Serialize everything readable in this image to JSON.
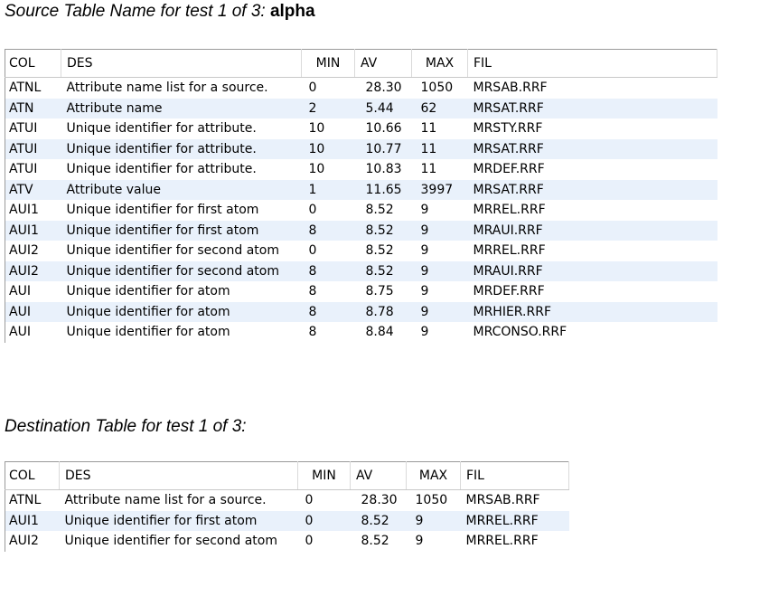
{
  "source": {
    "caption_italic": "Source Table Name for test 1 of 3: ",
    "caption_bold": "alpha",
    "headers": [
      "COL",
      "DES",
      "MIN",
      "AV",
      "MAX",
      "FIL"
    ],
    "rows": [
      [
        "ATNL",
        "Attribute name list for a source.",
        "0",
        "28.30",
        "1050",
        "MRSAB.RRF"
      ],
      [
        "ATN",
        "Attribute name",
        "2",
        "5.44",
        "62",
        "MRSAT.RRF"
      ],
      [
        "ATUI",
        "Unique identifier for attribute.",
        "10",
        "10.66",
        "11",
        "MRSTY.RRF"
      ],
      [
        "ATUI",
        "Unique identifier for attribute.",
        "10",
        "10.77",
        "11",
        "MRSAT.RRF"
      ],
      [
        "ATUI",
        "Unique identifier for attribute.",
        "10",
        "10.83",
        "11",
        "MRDEF.RRF"
      ],
      [
        "ATV",
        "Attribute value",
        "1",
        "11.65",
        "3997",
        "MRSAT.RRF"
      ],
      [
        "AUI1",
        "Unique identifier for first atom",
        "0",
        "8.52",
        "9",
        "MRREL.RRF"
      ],
      [
        "AUI1",
        "Unique identifier for first atom",
        "8",
        "8.52",
        "9",
        "MRAUI.RRF"
      ],
      [
        "AUI2",
        "Unique identifier for second atom",
        "0",
        "8.52",
        "9",
        "MRREL.RRF"
      ],
      [
        "AUI2",
        "Unique identifier for second atom",
        "8",
        "8.52",
        "9",
        "MRAUI.RRF"
      ],
      [
        "AUI",
        "Unique identifier for atom",
        "8",
        "8.75",
        "9",
        "MRDEF.RRF"
      ],
      [
        "AUI",
        "Unique identifier for atom",
        "8",
        "8.78",
        "9",
        "MRHIER.RRF"
      ],
      [
        "AUI",
        "Unique identifier for atom",
        "8",
        "8.84",
        "9",
        "MRCONSO.RRF"
      ]
    ]
  },
  "destination": {
    "caption_italic": "Destination Table for test 1 of 3:",
    "headers": [
      "COL",
      "DES",
      "MIN",
      "AV",
      "MAX",
      "FIL"
    ],
    "rows": [
      [
        "ATNL",
        "Attribute name list for a source.",
        "0",
        "28.30",
        "1050",
        "MRSAB.RRF"
      ],
      [
        "AUI1",
        "Unique identifier for first atom",
        "0",
        "8.52",
        "9",
        "MRREL.RRF"
      ],
      [
        "AUI2",
        "Unique identifier for second atom",
        "0",
        "8.52",
        "9",
        "MRREL.RRF"
      ]
    ]
  },
  "colors": {
    "stripe": "#e9f1fb",
    "border": "#9a9a9a"
  }
}
